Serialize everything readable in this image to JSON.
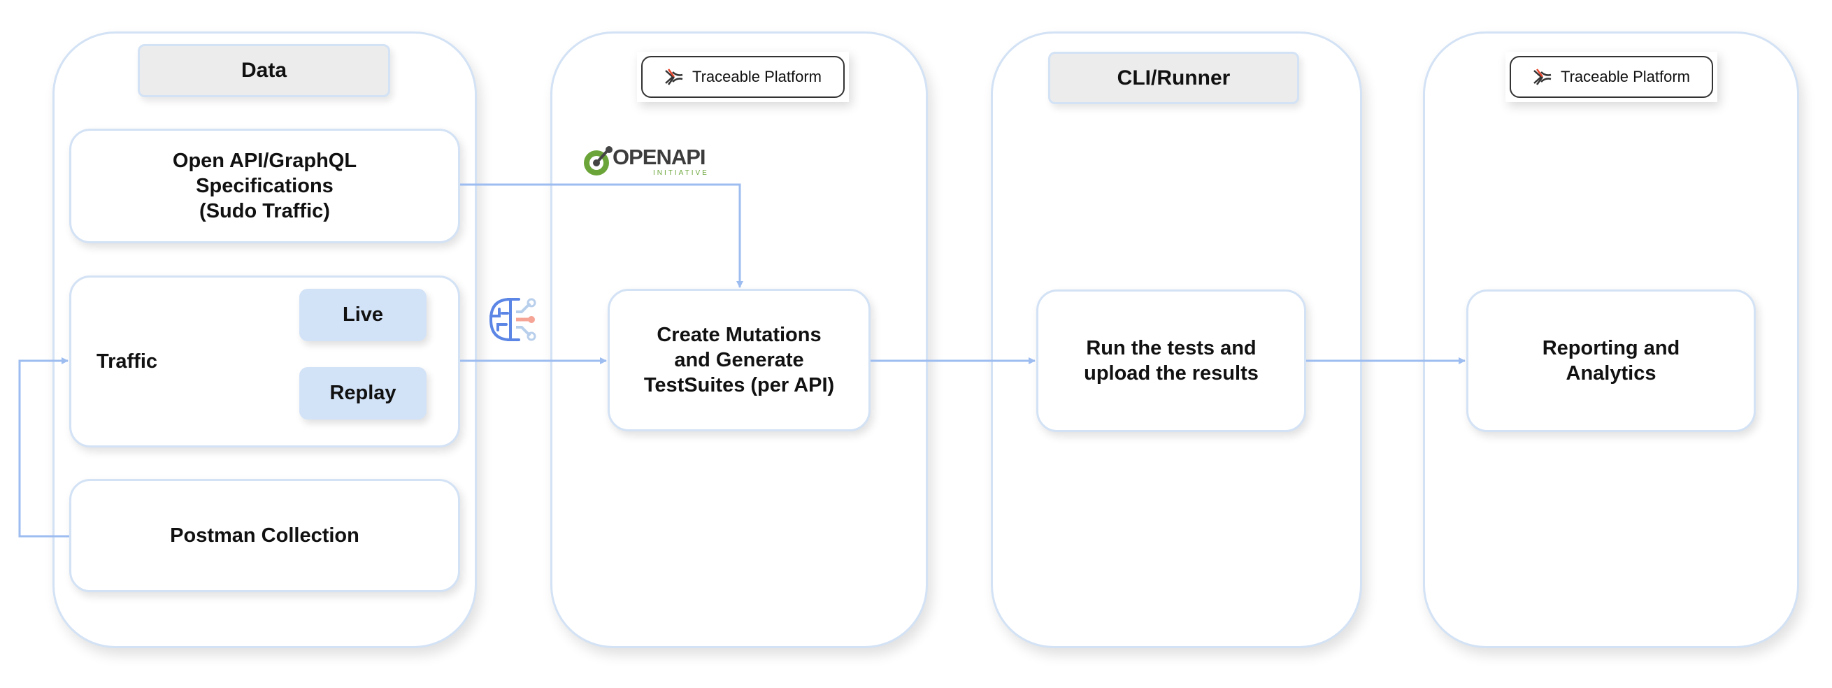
{
  "columns": {
    "data": {
      "header": "Data",
      "openapi_box": [
        "Open API/GraphQL",
        "Specifications",
        "(Sudo Traffic)"
      ],
      "traffic_box": {
        "label": "Traffic",
        "live": "Live",
        "replay": "Replay"
      },
      "postman_box": "Postman Collection"
    },
    "platform": {
      "badge": "Traceable Platform",
      "logo": {
        "main": "OPENAPI",
        "sub": "INITIATIVE"
      },
      "ai_icon": "ai-brain-icon",
      "box": [
        "Create Mutations",
        "and Generate",
        "TestSuites (per API)"
      ]
    },
    "runner": {
      "header": "CLI/Runner",
      "box": [
        "Run the tests and",
        "upload the results"
      ]
    },
    "reporting": {
      "badge": "Traceable Platform",
      "box": [
        "Reporting and",
        "Analytics"
      ]
    }
  },
  "colors": {
    "arrow": "#9dbcf0",
    "border": "#d3e2f5",
    "pill": "#d3e3f7",
    "header": "#ececec",
    "openapi_green": "#6ba539",
    "traceable_red": "#e8472e"
  }
}
